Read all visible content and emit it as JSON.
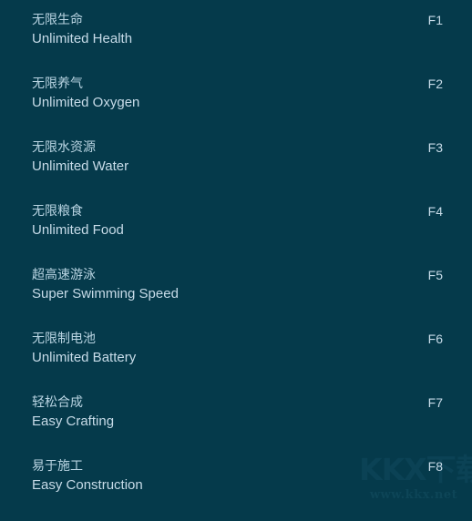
{
  "panel": {
    "background_color": "#053a4b",
    "text_color": "#c7dbe8",
    "hotkey_color": "#c7dbe8"
  },
  "cheats": [
    {
      "name_cn": "无限生命",
      "name_en": "Unlimited Health",
      "hotkey": "F1"
    },
    {
      "name_cn": "无限养气",
      "name_en": "Unlimited Oxygen",
      "hotkey": "F2"
    },
    {
      "name_cn": "无限水资源",
      "name_en": "Unlimited Water",
      "hotkey": "F3"
    },
    {
      "name_cn": "无限粮食",
      "name_en": "Unlimited Food",
      "hotkey": "F4"
    },
    {
      "name_cn": "超高速游泳",
      "name_en": "Super Swimming Speed",
      "hotkey": "F5"
    },
    {
      "name_cn": "无限制电池",
      "name_en": "Unlimited Battery",
      "hotkey": "F6"
    },
    {
      "name_cn": "轻松合成",
      "name_en": "Easy Crafting",
      "hotkey": "F7"
    },
    {
      "name_cn": "易于施工",
      "name_en": "Easy Construction",
      "hotkey": "F8"
    }
  ],
  "watermark": {
    "logo": "KKX下载",
    "url": "www.kkx.net",
    "color": "#0c4356"
  }
}
